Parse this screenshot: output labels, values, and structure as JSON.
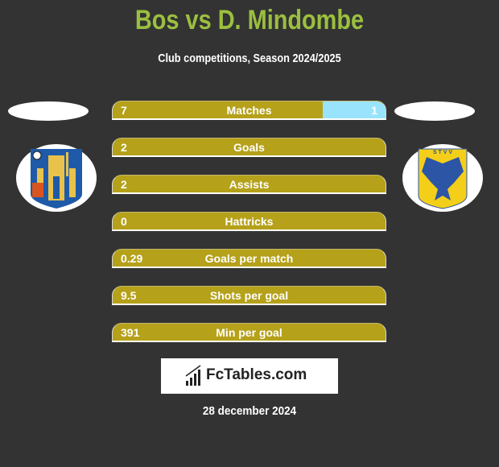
{
  "header": {
    "title": "Bos vs D. Mindombe",
    "subtitle": "Club competitions, Season 2024/2025"
  },
  "teams": {
    "left": {
      "logo": "westerlo-crest-icon"
    },
    "right": {
      "logo": "stvv-eagle-crest-icon"
    }
  },
  "colors": {
    "left_bar": "#b5a11a",
    "right_bar": "#99e4fc",
    "title": "#9bbf3f"
  },
  "stats": [
    {
      "label": "Matches",
      "left": "7",
      "right": "1",
      "right_share": 0.23
    },
    {
      "label": "Goals",
      "left": "2",
      "right": "",
      "right_share": 0
    },
    {
      "label": "Assists",
      "left": "2",
      "right": "",
      "right_share": 0
    },
    {
      "label": "Hattricks",
      "left": "0",
      "right": "",
      "right_share": 0
    },
    {
      "label": "Goals per match",
      "left": "0.29",
      "right": "",
      "right_share": 0
    },
    {
      "label": "Shots per goal",
      "left": "9.5",
      "right": "",
      "right_share": 0
    },
    {
      "label": "Min per goal",
      "left": "391",
      "right": "",
      "right_share": 0
    }
  ],
  "brand": {
    "name": "FcTables.com"
  },
  "date": "28 december 2024"
}
